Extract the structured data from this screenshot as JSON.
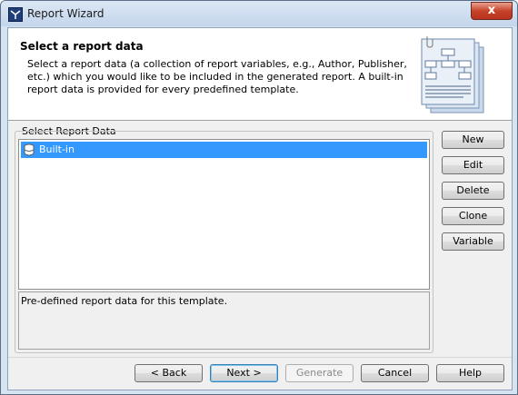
{
  "window": {
    "title": "Report Wizard",
    "close_label": "x"
  },
  "header": {
    "title": "Select a report data",
    "description": "Select a report data (a collection of report variables, e.g., Author, Publisher, etc.) which you would like to be included in the generated report. A built-in report data is provided for every predefined template."
  },
  "group": {
    "label": "Select Report Data"
  },
  "list": {
    "items": [
      {
        "label": "Built-in",
        "icon": "database-icon",
        "selected": true
      }
    ]
  },
  "details": {
    "text": "Pre-defined report data for this template."
  },
  "side_buttons": {
    "new": "New",
    "edit": "Edit",
    "delete": "Delete",
    "clone": "Clone",
    "variable": "Variable"
  },
  "footer_buttons": {
    "back": "< Back",
    "next": "Next >",
    "generate": "Generate",
    "cancel": "Cancel",
    "help": "Help"
  },
  "colors": {
    "selection": "#3399ff",
    "title_bar": "#c4d6ec",
    "close_button": "#c7432a"
  }
}
